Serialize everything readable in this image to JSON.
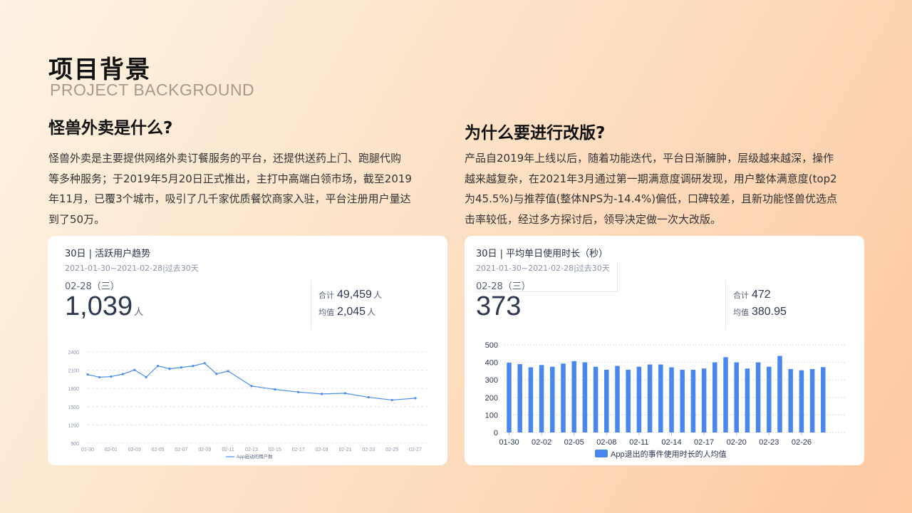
{
  "page": {
    "title": "项目背景",
    "subtitle": "PROJECT BACKGROUND"
  },
  "left": {
    "heading": "怪兽外卖是什么?",
    "paragraph_lines": [
      "怪兽外卖是主要提供网络外卖订餐服务的平台，还提供送药上门、跑腿代购",
      "等多种服务；于2019年5月20日正式推出，主打中高端白领市场，截至2019",
      "年11月，已覆3个城市，吸引了几千家优质餐饮商家入驻，平台注册用户量达",
      "到了50万。"
    ]
  },
  "right": {
    "heading": "为什么要进行改版?",
    "paragraph_lines": [
      "产品自2019年上线以后，随着功能迭代，平台日渐臃肿，层级越来越深，操作",
      "越来越复杂，在2021年3月通过第一期满意度调研发现，用户整体满意度(top2",
      "为45.5%)与推荐值(整体NPS为-14.4%)偏低，口碑较差，且新功能怪兽优选点",
      "击率较低，经过多方探讨后，领导决定做一次大改版。"
    ]
  },
  "card1": {
    "title": "30日 | 活跃用户趋势",
    "range": "2021-01-30~2021-02-28|过去30天",
    "date": "02-28（三）",
    "big_value": "1,039",
    "big_unit": "人",
    "total_label": "合计",
    "total_value": "49,459",
    "total_unit": "人",
    "avg_label": "均值",
    "avg_value": "2,045",
    "avg_unit": "人"
  },
  "card2": {
    "title": "30日 | 平均单日使用时长（秒）",
    "range": "2021-01-30~2021-02-28|过去30天",
    "date": "02-28（三）",
    "big_value": "373",
    "total_label": "合计",
    "total_value": "472",
    "avg_label": "均值",
    "avg_value": "380.95"
  },
  "chart_data": [
    {
      "type": "line",
      "series": [
        {
          "name": "App启动的用户数",
          "values": [
            2030,
            1985,
            1995,
            2035,
            2105,
            1985,
            2170,
            2125,
            2145,
            2170,
            2215,
            2040,
            2085,
            1840,
            1785,
            1740,
            1710,
            1720,
            1655,
            1610,
            1640
          ]
        }
      ],
      "x": [
        "01-30",
        "01-31",
        "02-01",
        "02-02",
        "02-03",
        "02-04",
        "02-05",
        "02-06",
        "02-07",
        "02-08",
        "02-09",
        "02-10",
        "02-11",
        "02-13",
        "02-15",
        "02-17",
        "02-19",
        "02-21",
        "02-23",
        "02-25",
        "02-27"
      ],
      "x_tick_labels": [
        "01-30",
        "02-01",
        "02-03",
        "02-05",
        "02-07",
        "02-09",
        "02-11",
        "02-13",
        "02-15",
        "02-17",
        "02-19",
        "02-21",
        "02-23",
        "02-25",
        "02-27"
      ],
      "y_ticks": [
        900,
        1200,
        1500,
        1800,
        2100,
        2400
      ],
      "ylim": [
        900,
        2400
      ],
      "grid": true,
      "legend": "bottom",
      "color": "#4a8cf0"
    },
    {
      "type": "bar",
      "series": [
        {
          "name": "App退出的事件使用时长的人均值",
          "values": [
            398,
            390,
            372,
            385,
            375,
            393,
            407,
            400,
            375,
            358,
            380,
            358,
            375,
            388,
            388,
            372,
            358,
            358,
            365,
            400,
            430,
            400,
            365,
            400,
            375,
            437,
            362,
            355,
            362,
            373
          ]
        }
      ],
      "x": [
        "01-30",
        "01-31",
        "02-01",
        "02-02",
        "02-03",
        "02-04",
        "02-05",
        "02-06",
        "02-07",
        "02-08",
        "02-09",
        "02-10",
        "02-11",
        "02-12",
        "02-13",
        "02-14",
        "02-15",
        "02-16",
        "02-17",
        "02-18",
        "02-19",
        "02-20",
        "02-21",
        "02-22",
        "02-23",
        "02-24",
        "02-25",
        "02-26",
        "02-27",
        "02-28"
      ],
      "x_tick_labels": [
        "01-30",
        "02-02",
        "02-05",
        "02-08",
        "02-11",
        "02-14",
        "02-17",
        "02-20",
        "02-23",
        "02-26"
      ],
      "y_ticks": [
        0,
        100,
        200,
        300,
        400,
        500
      ],
      "ylim": [
        0,
        500
      ],
      "grid": true,
      "legend": "bottom",
      "color": "#4a86f0"
    }
  ]
}
